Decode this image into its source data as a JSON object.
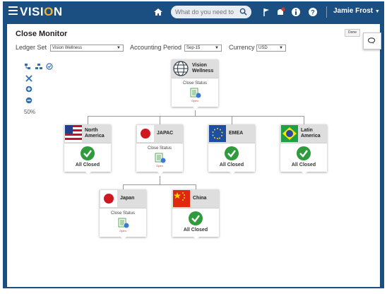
{
  "header": {
    "logo": "VISION",
    "search_placeholder": "What do you need to c",
    "user_name": "Jamie Frost",
    "icons": [
      "hamburger-icon",
      "home-icon",
      "search-icon",
      "flag-icon",
      "notifications-icon",
      "info-icon",
      "help-icon"
    ]
  },
  "page": {
    "title": "Close Monitor",
    "done_label": "Done",
    "zoom": "50%"
  },
  "filters": {
    "ledger_set_label": "Ledger Set",
    "ledger_set_value": "Vision Wellness",
    "period_label": "Accounting Period",
    "period_value": "Sep-15",
    "currency_label": "Currency",
    "currency_value": "USD"
  },
  "nodes": {
    "root": {
      "name": "Vision Wellness",
      "status": "Close Status",
      "state": "Open"
    },
    "north_america": {
      "name": "North America",
      "status": "All Closed"
    },
    "japac": {
      "name": "JAPAC",
      "status": "Close Status",
      "state": "Open"
    },
    "emea": {
      "name": "EMEA",
      "status": "All Closed"
    },
    "latin_america": {
      "name": "Latin America",
      "status": "All Closed"
    },
    "japan": {
      "name": "Japan",
      "status": "Close Status",
      "state": "Open"
    },
    "china": {
      "name": "China",
      "status": "All Closed"
    }
  },
  "colors": {
    "header_bg": "#1b4f82",
    "accent": "#f2b234",
    "closed_green": "#2f9b3c",
    "open_red": "#d13a2a"
  }
}
